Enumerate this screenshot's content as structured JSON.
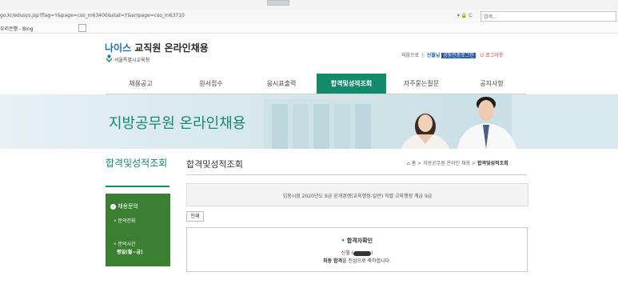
{
  "browser": {
    "url": "go.kr/edusys.jsp?flag=Y&page=cso_m63400&stat=Y&errpage=cso_m63710",
    "address_controls": "▾ 🔒 C",
    "search_placeholder": "검색...",
    "favorites": [
      "우리은행 - Bing"
    ]
  },
  "header": {
    "logo_prefix": "나이스",
    "logo_rest": " 교직원 온라인채용",
    "logo_sub": "서울특별시교육청",
    "util_home": "처음으로",
    "util_name": "신월님",
    "util_badge": "공동인증로그인",
    "util_logout": "로그아웃"
  },
  "nav": {
    "items": [
      {
        "label": "채용공고"
      },
      {
        "label": "원서접수"
      },
      {
        "label": "응시표출력"
      },
      {
        "label": "합격및성적조회"
      },
      {
        "label": "자주묻는질문"
      },
      {
        "label": "공지사항"
      }
    ],
    "active_index": 3
  },
  "banner": {
    "title": "지방공무원 온라인채용"
  },
  "left": {
    "title": "합격및성적조회",
    "box_head": "채용문의",
    "box_sub1": "• 문의전화",
    "box_sub2": "• 문의시간",
    "box_sub3": "평일(월~금)"
  },
  "main": {
    "page_title": "합격및성적조회",
    "breadcrumb_home": "홈",
    "breadcrumb_mid": " > 지방공무원 온라인 채용 > ",
    "breadcrumb_last": "합격및성적조회",
    "info_line": "임용시험 2020년도 9급 공개경쟁(교육행정-일반)    직렬 교육행정    계급 9급",
    "print_label": "인쇄",
    "result_head": "합격자확인",
    "result_name_prefix": "신월 (",
    "result_name_suffix": ")",
    "result_msg_bold": "최종 합격",
    "result_msg_pre": "최종 ",
    "result_msg": "을 진심으로 축하합니다."
  },
  "colors": {
    "accent_green": "#138a6a",
    "left_box": "#3b7f32",
    "banner_bg": "#dcebf0"
  }
}
